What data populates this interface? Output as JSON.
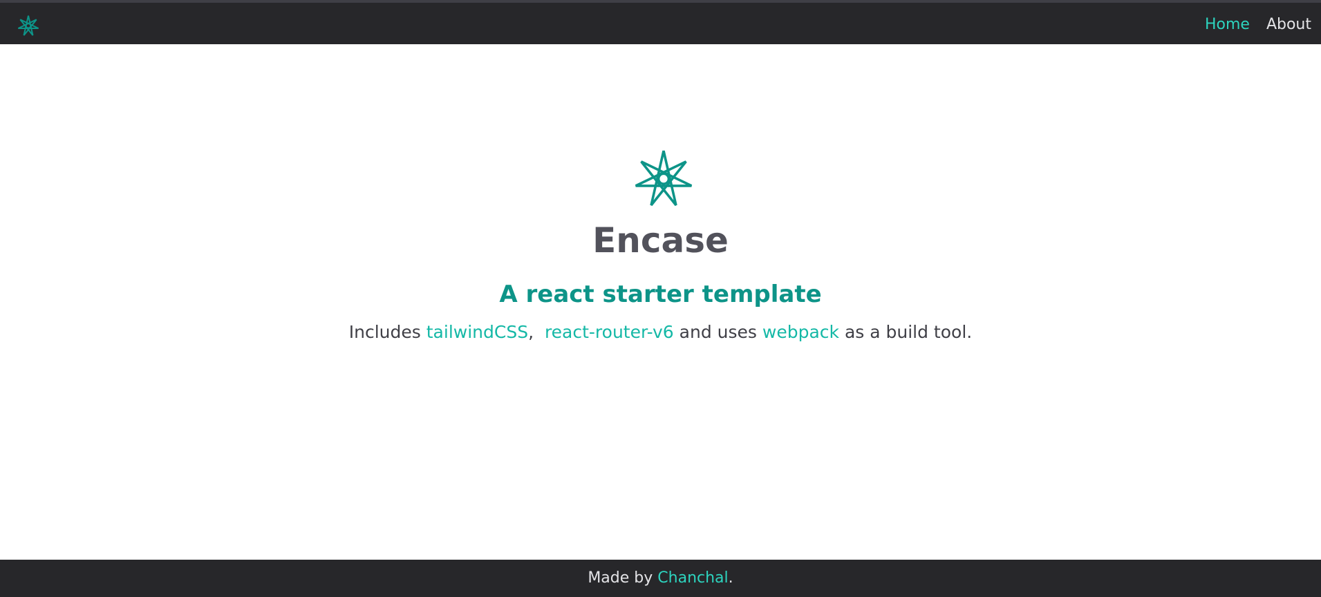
{
  "colors": {
    "navbar_bg": "#27272a",
    "accent": "#14b8a6",
    "accent_dark": "#0d9488",
    "active_link": "#2dd4bf",
    "title_text": "#52525b",
    "body_text": "#3f3f46"
  },
  "nav": {
    "logo_icon": "seven-point-star-icon",
    "links": [
      {
        "label": "Home",
        "active": true
      },
      {
        "label": "About",
        "active": false
      }
    ]
  },
  "hero": {
    "logo_icon": "seven-point-star-icon",
    "title": "Encase",
    "subtitle": "A react starter template",
    "description": {
      "prefix": "Includes",
      "link1": "tailwindCSS",
      "separator": ",",
      "link2": "react-router-v6",
      "middle": "and uses",
      "link3": "webpack",
      "suffix": "as a build tool."
    }
  },
  "footer": {
    "prefix": "Made by",
    "author": "Chanchal",
    "suffix": "."
  }
}
